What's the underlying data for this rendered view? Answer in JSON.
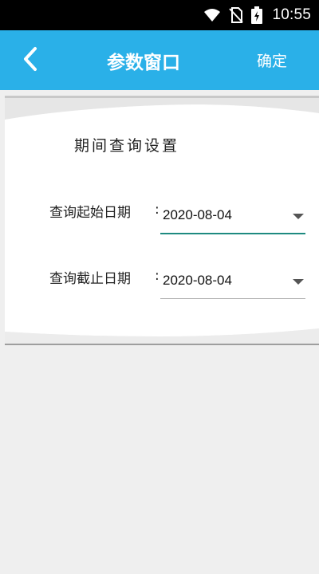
{
  "status_bar": {
    "time": "10:55",
    "icons": [
      "wifi-icon",
      "no-sim-icon",
      "battery-charging-icon"
    ]
  },
  "app_bar": {
    "back_icon": "chevron-left-icon",
    "title": "参数窗口",
    "confirm_label": "确定",
    "color": "#2ab0e8"
  },
  "panel": {
    "title": "期间查询设置",
    "fields": [
      {
        "label": "查询起始日期",
        "colon": ":",
        "value": "2020-08-04",
        "focused": true
      },
      {
        "label": "查询截止日期",
        "colon": ":",
        "value": "2020-08-04",
        "focused": false
      }
    ]
  },
  "colors": {
    "background": "#efefef",
    "accent_underline": "#1e8a80"
  }
}
